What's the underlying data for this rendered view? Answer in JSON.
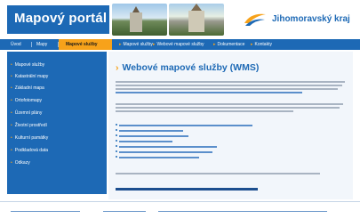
{
  "header": {
    "brand_title": "Mapový portál",
    "region_name": "Jihomoravský kraj",
    "icons": [
      "regional-logo-icon"
    ]
  },
  "nav": {
    "items": [
      {
        "label": "Úvod"
      },
      {
        "label": "Mapy"
      },
      {
        "label": "Mapové služby",
        "active": true
      }
    ],
    "breadcrumb": [
      "Mapové služby",
      "Webové mapové služby",
      "Dokumentace",
      "Kontakty"
    ]
  },
  "sidebar": {
    "items": [
      "Mapové služby",
      "Katastrální mapy",
      "Základní mapa",
      "Ortofotomapy",
      "Územní plány",
      "Životní prostředí",
      "Kulturní památky",
      "Podkladová data",
      "Odkazy"
    ]
  },
  "main": {
    "title": "Webové mapové služby (WMS)"
  },
  "colors": {
    "brand_blue": "#1d69b5",
    "accent_orange": "#f7a21a",
    "content_bg": "#f2f6fb"
  }
}
